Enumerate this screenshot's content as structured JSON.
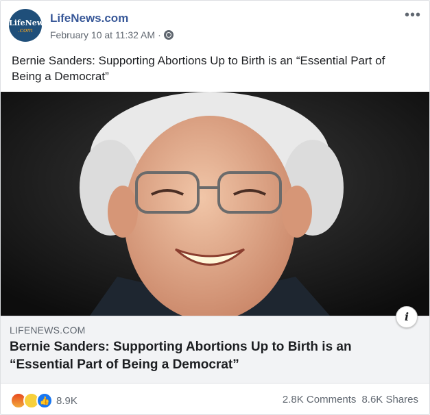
{
  "header": {
    "page_name": "LifeNews.com",
    "avatar_line1": "LifeNews",
    "avatar_line2": ".com",
    "timestamp": "February 10 at 11:32 AM",
    "separator": "·",
    "privacy_icon": "globe-icon",
    "more_label": "•••"
  },
  "post": {
    "text": "Bernie Sanders: Supporting Abortions Up to Birth is an “Essential Part of Being a Democrat”"
  },
  "link_preview": {
    "domain": "LIFENEWS.COM",
    "title": "Bernie Sanders: Supporting Abortions Up to Birth is an “Essential Part of Being a Democrat”",
    "info_label": "i"
  },
  "footer": {
    "reactions": [
      "angry-icon",
      "sad-icon",
      "like-icon"
    ],
    "reaction_count": "8.9K",
    "comments": "2.8K Comments",
    "shares": "8.6K Shares"
  },
  "colors": {
    "page_name": "#385898",
    "text": "#1c1e21",
    "secondary": "#606770",
    "link_bg": "#f2f3f5"
  }
}
